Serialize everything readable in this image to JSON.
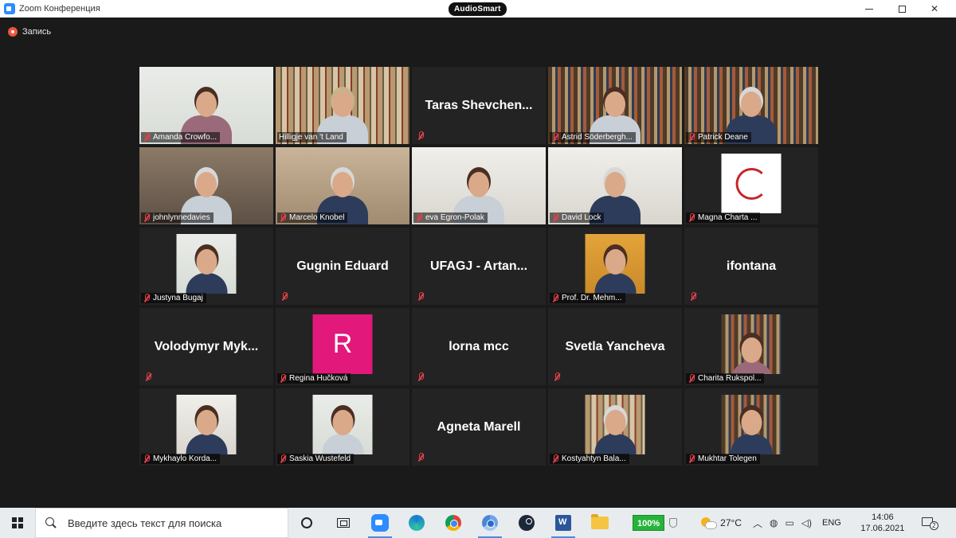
{
  "window": {
    "title": "Zoom Конференция",
    "overlay_badge": "AudioSmart"
  },
  "recording": {
    "label": "Запись"
  },
  "participants": [
    {
      "name": "Amanda Crowfo...",
      "video": true
    },
    {
      "name": "Hilligje van 't Land",
      "video": true,
      "active_speaker": true
    },
    {
      "name": "Taras  Shevchen...",
      "video": false
    },
    {
      "name": "Astrid Söderbergh...",
      "video": true
    },
    {
      "name": "Patrick Deane",
      "video": true
    },
    {
      "name": "johnlynnedavies",
      "video": true
    },
    {
      "name": "Marcelo Knobel",
      "video": true
    },
    {
      "name": "eva Egron-Polak",
      "video": true
    },
    {
      "name": "David Lock",
      "video": true
    },
    {
      "name": "Magna Charta ...",
      "video": true,
      "logo": true
    },
    {
      "name": "Justyna Bugaj",
      "video": true
    },
    {
      "name": "Gugnin Eduard",
      "video": false
    },
    {
      "name": "UFAGJ  - Artan...",
      "video": false
    },
    {
      "name": "Prof. Dr. Mehm...",
      "video": true
    },
    {
      "name": "ifontana",
      "video": false
    },
    {
      "name": "Volodymyr  Myk...",
      "video": false
    },
    {
      "name": "Regina Hučková",
      "video": true,
      "avatar_letter": "R"
    },
    {
      "name": "lorna mcc",
      "video": false
    },
    {
      "name": "Svetla Yancheva",
      "video": false
    },
    {
      "name": "Charita Rukspol...",
      "video": true
    },
    {
      "name": "Mykhaylo Korda...",
      "video": true
    },
    {
      "name": "Saskia Wustefeld",
      "video": true
    },
    {
      "name": "Agneta Marell",
      "video": false
    },
    {
      "name": "Kostyahtyn Bala...",
      "video": true
    },
    {
      "name": "Mukhtar Tolegen",
      "video": true
    }
  ],
  "taskbar": {
    "search_placeholder": "Введите здесь текст для поиска",
    "battery": "100%",
    "weather": "27°C",
    "language": "ENG",
    "time": "14:06",
    "date": "17.06.2021",
    "notification_count": "2"
  },
  "colors": {
    "active_speaker": "#a3d15c",
    "muted_icon": "#e8414a",
    "record": "#f0553c",
    "avatar_r": "#e2197b",
    "battery": "#27b33a"
  }
}
